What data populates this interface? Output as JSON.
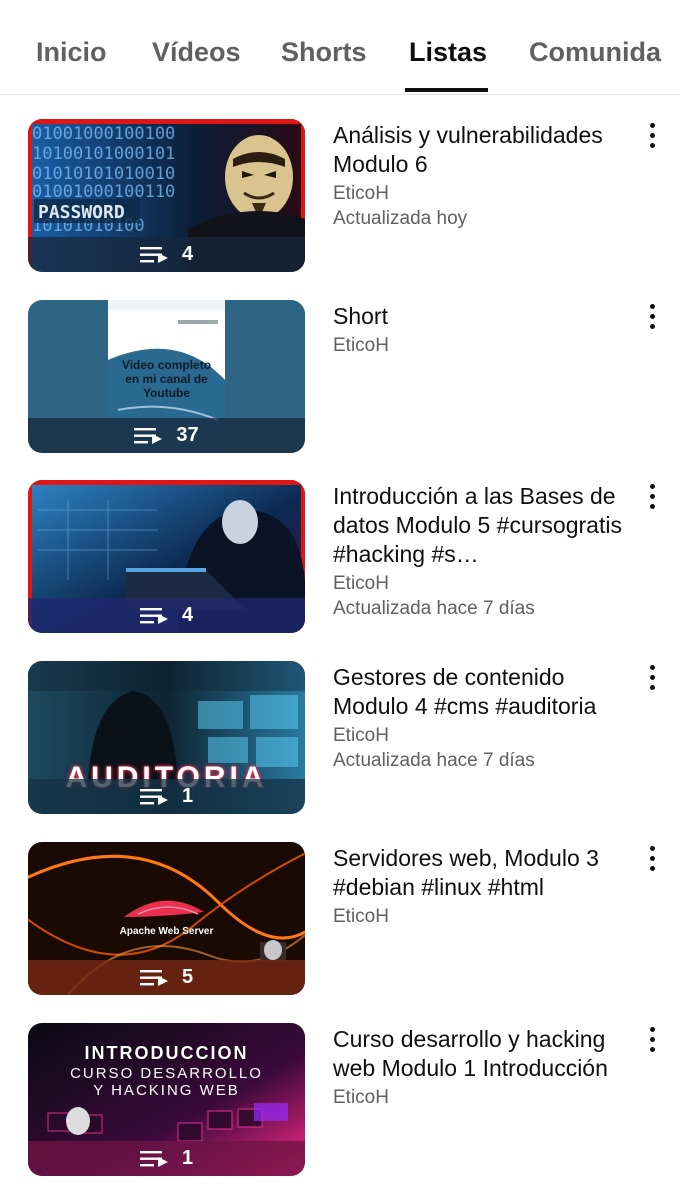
{
  "tabs": [
    {
      "label": "Inicio"
    },
    {
      "label": "Vídeos"
    },
    {
      "label": "Shorts"
    },
    {
      "label": "Listas"
    },
    {
      "label": "Comunida"
    }
  ],
  "active_tab": "Listas",
  "playlists": [
    {
      "title": "Análisis y vulnerabilidades Modulo 6",
      "channel": "EticoH",
      "updated": "Actualizada hoy",
      "count": "4"
    },
    {
      "title": "Short",
      "channel": "EticoH",
      "updated": "",
      "count": "37",
      "thumb_text": "Video completo en mi canal de Youtube"
    },
    {
      "title": "Introducción a las Bases de datos Modulo 5 #cursogratis #hacking #s…",
      "channel": "EticoH",
      "updated": "Actualizada hace 7 días",
      "count": "4"
    },
    {
      "title": "Gestores de contenido Modulo 4 #cms #auditoria",
      "channel": "EticoH",
      "updated": "Actualizada hace 7 días",
      "count": "1",
      "thumb_text": "AUDITORIA"
    },
    {
      "title": "Servidores web, Modulo 3 #debian #linux #html",
      "channel": "EticoH",
      "updated": "",
      "count": "5",
      "thumb_text": "Apache Web Server"
    },
    {
      "title": "Curso desarrollo y hacking web Modulo 1 Introducción",
      "channel": "EticoH",
      "updated": "",
      "count": "1",
      "thumb_text_1": "INTRODUCCION",
      "thumb_text_2": "CURSO DESARROLLO",
      "thumb_text_3": "Y HACKING WEB"
    }
  ],
  "icons": {
    "playlist": "playlist-icon",
    "more": "more-vert-icon"
  }
}
